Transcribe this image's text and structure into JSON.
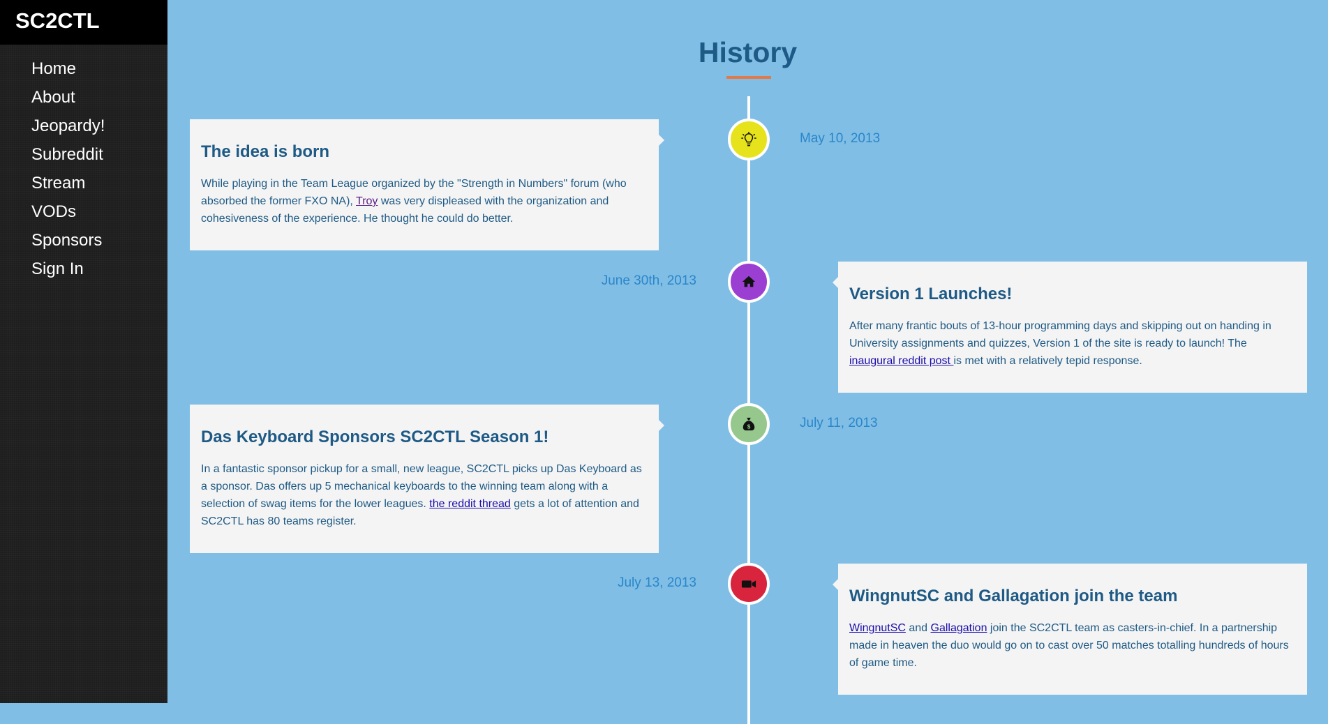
{
  "brand": "SC2CTL",
  "nav": [
    "Home",
    "About",
    "Jeopardy!",
    "Subreddit",
    "Stream",
    "VODs",
    "Sponsors",
    "Sign In"
  ],
  "page_title": "History",
  "colors": {
    "background": "#80bee6",
    "sidebar": "#1e1e1e",
    "title": "#1e5a85",
    "underline_accent": "#e07a4b",
    "date_text": "#2a86c8"
  },
  "events": [
    {
      "title": "The idea is born",
      "date": "May 10, 2013",
      "icon": "lightbulb-icon",
      "icon_color": "#e6e21c",
      "body": {
        "t1": "While playing in the Team League organized by the \"Strength in Numbers\" forum (who absorbed the former FXO NA), ",
        "link1": "Troy",
        "t2": " was very displeased with the organization and cohesiveness of the experience. He thought he could do better."
      }
    },
    {
      "title": "Version 1 Launches!",
      "date": "June 30th, 2013",
      "icon": "home-icon",
      "icon_color": "#9b3fd2",
      "body": {
        "t1": "After many frantic bouts of 13-hour programming days and skipping out on handing in University assignments and quizzes, Version 1 of the site is ready to launch! The ",
        "link1": "inaugural reddit post ",
        "t2": "is met with a relatively tepid response."
      }
    },
    {
      "title": "Das Keyboard Sponsors SC2CTL Season 1!",
      "date": "July 11, 2013",
      "icon": "money-bag-icon",
      "icon_color": "#96c88e",
      "body": {
        "t1": "In a fantastic sponsor pickup for a small, new league, SC2CTL picks up Das Keyboard as a sponsor. Das offers up 5 mechanical keyboards to the winning team along with a selection of swag items for the lower leagues. ",
        "link1": "the reddit thread",
        "t2": " gets a lot of attention and SC2CTL has 80 teams register."
      }
    },
    {
      "title": "WingnutSC and Gallagation join the team",
      "date": "July 13, 2013",
      "icon": "video-camera-icon",
      "icon_color": "#d9243e",
      "body": {
        "link1": "WingnutSC",
        "t1": " and ",
        "link2": "Gallagation",
        "t2": " join the SC2CTL team as casters-in-chief. In a partnership made in heaven the duo would go on to cast over 50 matches totalling hundreds of hours of game time."
      }
    }
  ]
}
